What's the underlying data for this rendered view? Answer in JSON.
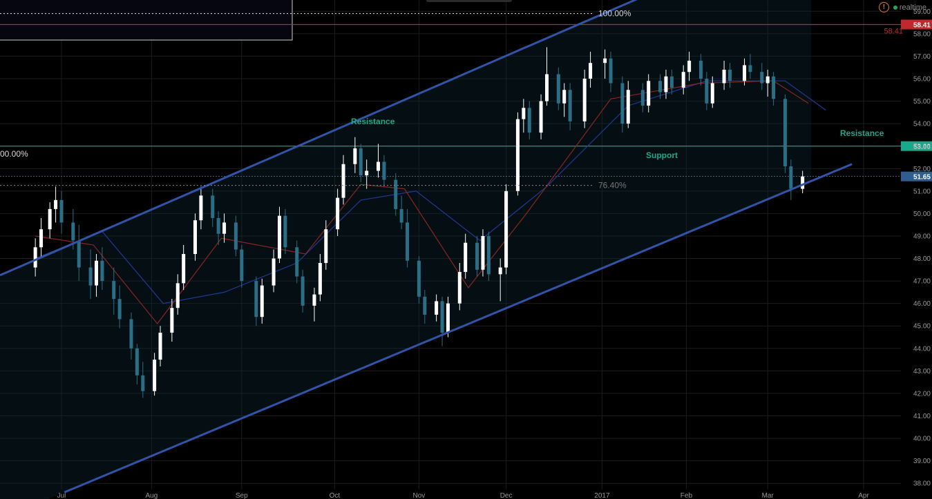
{
  "chart_data": {
    "type": "candlestick",
    "title": "",
    "xlabel": "",
    "ylabel": "",
    "ylim": [
      37.3,
      59.5
    ],
    "y_ticks": [
      "38.00",
      "39.00",
      "40.00",
      "41.00",
      "42.00",
      "43.00",
      "44.00",
      "45.00",
      "46.00",
      "47.00",
      "48.00",
      "49.00",
      "50.00",
      "51.00",
      "52.00",
      "53.00",
      "54.00",
      "55.00",
      "56.00",
      "57.00",
      "58.00",
      "59.00"
    ],
    "x_ticks": [
      {
        "label": "Jul",
        "date": "2016-07-01"
      },
      {
        "label": "Aug",
        "date": "2016-08-01"
      },
      {
        "label": "Sep",
        "date": "2016-09-01"
      },
      {
        "label": "Oct",
        "date": "2016-10-03"
      },
      {
        "label": "Nov",
        "date": "2016-11-01"
      },
      {
        "label": "Dec",
        "date": "2016-12-01"
      },
      {
        "label": "2017",
        "date": "2017-01-03"
      },
      {
        "label": "Feb",
        "date": "2017-02-01"
      },
      {
        "label": "Mar",
        "date": "2017-03-01"
      },
      {
        "label": "Apr",
        "date": "2017-04-03"
      }
    ],
    "grid": true,
    "price_labels": {
      "high_marker": "58.41",
      "resistance": "53.00",
      "last": "51.65"
    },
    "annotations": {
      "fib_top": "100.00%",
      "fib_left": "00.00%",
      "fib_mid": "76.40%",
      "resistance_1": "Resistance",
      "resistance_2": "Resistance",
      "support": "Support"
    },
    "horizontal_levels": [
      {
        "value": 58.41,
        "color": "#c0292b"
      },
      {
        "value": 53.0,
        "color": "#1aa88a"
      },
      {
        "value": 51.65,
        "color": "#5b84b8"
      }
    ],
    "channel": {
      "upper": {
        "from": {
          "date": "2016-06-16",
          "value": 47.6
        },
        "to": {
          "date": "2017-01-25",
          "value": 60.1
        }
      },
      "lower": {
        "from": {
          "date": "2016-07-02",
          "value": 37.6
        },
        "to": {
          "date": "2017-03-30",
          "value": 52.2
        }
      }
    },
    "series": [
      {
        "name": "",
        "kind": "candles",
        "ohlc": [
          [
            "2016-06-22",
            47.6,
            48.9,
            47.2,
            48.5
          ],
          [
            "2016-06-24",
            48.5,
            49.8,
            48.0,
            49.3
          ],
          [
            "2016-06-27",
            49.3,
            50.5,
            48.9,
            50.2
          ],
          [
            "2016-06-29",
            50.2,
            51.2,
            49.6,
            50.6
          ],
          [
            "2016-07-01",
            50.6,
            51.0,
            49.1,
            49.6
          ],
          [
            "2016-07-05",
            49.6,
            50.2,
            48.4,
            48.8
          ],
          [
            "2016-07-07",
            48.8,
            49.5,
            47.0,
            47.6
          ],
          [
            "2016-07-11",
            47.6,
            48.4,
            46.2,
            46.8
          ],
          [
            "2016-07-13",
            46.8,
            48.2,
            46.3,
            47.9
          ],
          [
            "2016-07-15",
            47.9,
            48.5,
            46.6,
            47.0
          ],
          [
            "2016-07-19",
            47.0,
            47.6,
            45.5,
            46.2
          ],
          [
            "2016-07-21",
            46.2,
            46.8,
            44.9,
            45.3
          ],
          [
            "2016-07-25",
            45.3,
            45.6,
            43.5,
            44.0
          ],
          [
            "2016-07-27",
            44.0,
            44.2,
            42.4,
            42.8
          ],
          [
            "2016-07-29",
            42.8,
            43.4,
            41.8,
            42.1
          ],
          [
            "2016-08-02",
            42.1,
            43.8,
            41.9,
            43.5
          ],
          [
            "2016-08-04",
            43.5,
            45.0,
            43.2,
            44.7
          ],
          [
            "2016-08-08",
            44.7,
            46.2,
            44.3,
            45.8
          ],
          [
            "2016-08-10",
            45.8,
            47.3,
            45.5,
            46.9
          ],
          [
            "2016-08-12",
            46.9,
            48.6,
            46.6,
            48.2
          ],
          [
            "2016-08-16",
            48.2,
            50.0,
            47.9,
            49.7
          ],
          [
            "2016-08-18",
            49.7,
            51.2,
            49.3,
            50.8
          ],
          [
            "2016-08-22",
            50.8,
            51.1,
            49.4,
            49.8
          ],
          [
            "2016-08-24",
            49.8,
            50.1,
            48.6,
            49.1
          ],
          [
            "2016-08-26",
            49.1,
            50.0,
            48.7,
            49.6
          ],
          [
            "2016-08-30",
            49.6,
            49.9,
            48.1,
            48.4
          ],
          [
            "2016-09-01",
            48.4,
            48.6,
            46.7,
            47.0
          ],
          [
            "2016-09-06",
            47.0,
            47.2,
            45.0,
            45.4
          ],
          [
            "2016-09-08",
            45.4,
            47.1,
            45.1,
            46.8
          ],
          [
            "2016-09-12",
            46.8,
            48.4,
            46.5,
            48.0
          ],
          [
            "2016-09-14",
            48.0,
            50.3,
            47.8,
            49.9
          ],
          [
            "2016-09-16",
            49.9,
            50.2,
            48.2,
            48.5
          ],
          [
            "2016-09-20",
            48.5,
            48.8,
            46.9,
            47.2
          ],
          [
            "2016-09-22",
            47.2,
            47.5,
            45.6,
            45.9
          ],
          [
            "2016-09-26",
            45.9,
            46.7,
            45.2,
            46.4
          ],
          [
            "2016-09-28",
            46.4,
            48.2,
            46.1,
            47.8
          ],
          [
            "2016-09-30",
            47.8,
            49.7,
            47.5,
            49.3
          ],
          [
            "2016-10-04",
            49.3,
            51.1,
            49.0,
            50.7
          ],
          [
            "2016-10-06",
            50.7,
            52.6,
            50.4,
            52.2
          ],
          [
            "2016-10-10",
            52.2,
            53.4,
            51.8,
            52.9
          ],
          [
            "2016-10-12",
            52.9,
            53.1,
            51.4,
            51.7
          ],
          [
            "2016-10-14",
            51.7,
            52.4,
            51.1,
            51.9
          ],
          [
            "2016-10-18",
            51.9,
            53.1,
            51.6,
            52.3
          ],
          [
            "2016-10-20",
            52.3,
            52.6,
            51.2,
            51.5
          ],
          [
            "2016-10-24",
            51.5,
            51.8,
            49.9,
            50.2
          ],
          [
            "2016-10-26",
            50.2,
            50.8,
            49.3,
            49.6
          ],
          [
            "2016-10-28",
            49.6,
            50.2,
            47.6,
            47.9
          ],
          [
            "2016-11-01",
            47.9,
            48.1,
            46.0,
            46.3
          ],
          [
            "2016-11-03",
            46.3,
            46.6,
            45.1,
            45.5
          ],
          [
            "2016-11-07",
            45.5,
            46.4,
            45.2,
            46.1
          ],
          [
            "2016-11-09",
            46.1,
            46.3,
            44.1,
            44.7
          ],
          [
            "2016-11-11",
            44.7,
            46.3,
            44.5,
            46.0
          ],
          [
            "2016-11-15",
            46.0,
            47.8,
            45.7,
            47.4
          ],
          [
            "2016-11-17",
            47.4,
            49.1,
            47.1,
            48.7
          ],
          [
            "2016-11-21",
            48.7,
            49.0,
            47.2,
            47.5
          ],
          [
            "2016-11-23",
            47.5,
            49.3,
            47.2,
            49.0
          ],
          [
            "2016-11-25",
            49.0,
            49.2,
            47.0,
            47.3
          ],
          [
            "2016-11-29",
            47.3,
            48.0,
            46.1,
            47.6
          ],
          [
            "2016-12-01",
            47.6,
            51.3,
            47.3,
            51.0
          ],
          [
            "2016-12-05",
            51.0,
            54.5,
            50.8,
            54.2
          ],
          [
            "2016-12-07",
            54.2,
            55.1,
            53.6,
            54.7
          ],
          [
            "2016-12-09",
            54.7,
            55.0,
            53.3,
            53.6
          ],
          [
            "2016-12-13",
            53.6,
            55.3,
            53.3,
            55.0
          ],
          [
            "2016-12-15",
            55.0,
            57.4,
            54.8,
            56.2
          ],
          [
            "2016-12-19",
            56.2,
            56.5,
            54.6,
            54.9
          ],
          [
            "2016-12-21",
            54.9,
            55.8,
            54.3,
            55.5
          ],
          [
            "2016-12-23",
            55.5,
            55.8,
            53.7,
            54.1
          ],
          [
            "2016-12-28",
            54.1,
            56.4,
            53.8,
            56.0
          ],
          [
            "2016-12-30",
            56.0,
            57.2,
            55.6,
            56.7
          ],
          [
            "2017-01-04",
            56.7,
            57.3,
            56.0,
            56.9
          ],
          [
            "2017-01-06",
            56.9,
            57.2,
            55.4,
            55.8
          ],
          [
            "2017-01-10",
            55.8,
            56.1,
            53.6,
            54.0
          ],
          [
            "2017-01-12",
            54.0,
            55.9,
            53.8,
            55.5
          ],
          [
            "2017-01-17",
            55.5,
            55.8,
            54.5,
            54.8
          ],
          [
            "2017-01-19",
            54.8,
            56.2,
            54.5,
            55.9
          ],
          [
            "2017-01-23",
            55.9,
            56.2,
            55.1,
            55.4
          ],
          [
            "2017-01-25",
            55.4,
            56.4,
            55.1,
            56.1
          ],
          [
            "2017-01-27",
            56.1,
            56.4,
            55.3,
            55.6
          ],
          [
            "2017-01-31",
            55.6,
            56.6,
            55.3,
            56.3
          ],
          [
            "2017-02-02",
            56.3,
            57.2,
            55.9,
            56.8
          ],
          [
            "2017-02-06",
            56.8,
            57.1,
            55.7,
            56.0
          ],
          [
            "2017-02-08",
            56.0,
            56.3,
            54.6,
            54.9
          ],
          [
            "2017-02-10",
            54.9,
            56.1,
            54.7,
            55.8
          ],
          [
            "2017-02-14",
            55.8,
            56.8,
            55.5,
            56.4
          ],
          [
            "2017-02-16",
            56.4,
            56.7,
            55.6,
            55.9
          ],
          [
            "2017-02-21",
            55.9,
            56.9,
            55.7,
            56.6
          ],
          [
            "2017-02-23",
            56.6,
            57.1,
            56.0,
            56.3
          ],
          [
            "2017-02-27",
            56.3,
            56.7,
            55.5,
            55.8
          ],
          [
            "2017-03-01",
            55.8,
            56.4,
            55.2,
            56.1
          ],
          [
            "2017-03-03",
            56.1,
            56.3,
            54.8,
            55.1
          ],
          [
            "2017-03-07",
            55.1,
            55.3,
            51.8,
            52.1
          ],
          [
            "2017-03-09",
            52.1,
            52.4,
            50.6,
            51.1
          ],
          [
            "2017-03-13",
            51.1,
            51.9,
            50.9,
            51.65
          ]
        ]
      },
      {
        "name": "",
        "kind": "line",
        "color": "#1e3a96",
        "points": [
          [
            "2016-06-22",
            48.0
          ],
          [
            "2016-07-15",
            49.2
          ],
          [
            "2016-08-05",
            46.0
          ],
          [
            "2016-08-26",
            46.5
          ],
          [
            "2016-09-20",
            47.8
          ],
          [
            "2016-10-12",
            50.6
          ],
          [
            "2016-10-31",
            51.0
          ],
          [
            "2016-11-22",
            48.8
          ],
          [
            "2016-12-15",
            51.2
          ],
          [
            "2017-01-12",
            54.8
          ],
          [
            "2017-02-08",
            55.9
          ],
          [
            "2017-03-07",
            55.9
          ],
          [
            "2017-03-21",
            54.6
          ]
        ]
      },
      {
        "name": "",
        "kind": "line",
        "color": "#8a2525",
        "points": [
          [
            "2016-06-22",
            49.0
          ],
          [
            "2016-07-12",
            48.6
          ],
          [
            "2016-08-03",
            45.1
          ],
          [
            "2016-08-25",
            48.9
          ],
          [
            "2016-09-23",
            48.2
          ],
          [
            "2016-10-12",
            51.3
          ],
          [
            "2016-10-27",
            51.1
          ],
          [
            "2016-11-18",
            46.7
          ],
          [
            "2016-12-08",
            50.0
          ],
          [
            "2017-01-06",
            55.1
          ],
          [
            "2017-02-06",
            55.8
          ],
          [
            "2017-03-03",
            55.9
          ],
          [
            "2017-03-15",
            54.9
          ]
        ]
      }
    ]
  },
  "status": {
    "alert_symbol": "!",
    "realtime_label": "realtime"
  }
}
